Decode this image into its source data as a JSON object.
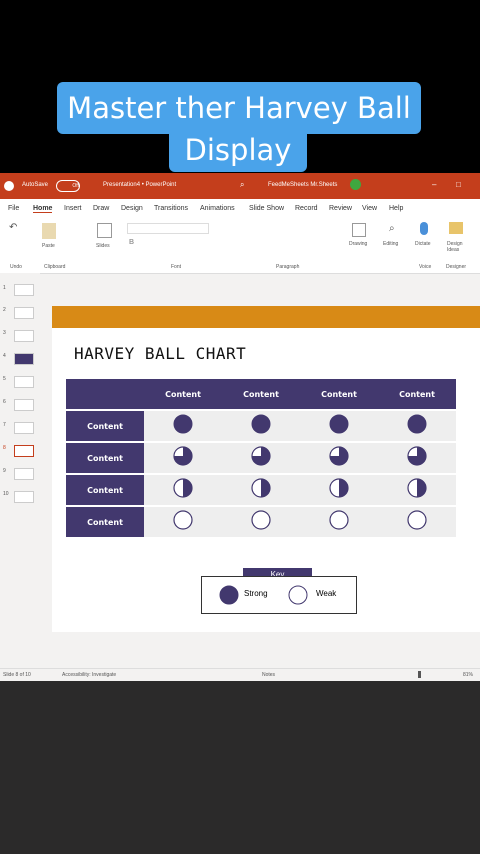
{
  "caption": {
    "line1": "Master ther Harvey Ball",
    "line2": "Display"
  },
  "titlebar": {
    "autosave": "AutoSave",
    "toggle": "Off",
    "filename": "Presentation4 • PowerPoint",
    "user": "FeedMeSheets Mr.Sheets"
  },
  "menu": [
    "File",
    "Home",
    "Insert",
    "Draw",
    "Design",
    "Transitions",
    "Animations",
    "Slide Show",
    "Record",
    "Review",
    "View",
    "Help"
  ],
  "ribbon": {
    "undo": "Undo",
    "clipboard": "Clipboard",
    "paste": "Paste",
    "slides": "Slides",
    "font": "Font",
    "paragraph": "Paragraph",
    "drawing": "Drawing",
    "editing": "Editing",
    "dictate": "Dictate",
    "voice": "Voice",
    "designer": "Design Ideas",
    "designer_group": "Designer"
  },
  "thumbnails": [
    "1",
    "2",
    "3",
    "4",
    "5",
    "6",
    "7",
    "8",
    "9",
    "10"
  ],
  "slide": {
    "title": "HARVEY BALL CHART",
    "headers": [
      "Content",
      "Content",
      "Content",
      "Content"
    ],
    "rows": [
      {
        "label": "Content",
        "values": [
          1,
          1,
          1,
          1
        ]
      },
      {
        "label": "Content",
        "values": [
          0.75,
          0.75,
          0.75,
          0.75
        ]
      },
      {
        "label": "Content",
        "values": [
          0.5,
          0.5,
          0.5,
          0.5
        ]
      },
      {
        "label": "Content",
        "values": [
          0,
          0,
          0,
          0
        ]
      }
    ],
    "key": {
      "title": "Key",
      "strong": "Strong",
      "weak": "Weak"
    }
  },
  "status": {
    "slide": "Slide 8 of 10",
    "accessibility": "Accessibility: Investigate",
    "notes": "Notes",
    "zoom": "81%"
  },
  "colors": {
    "accent": "#42386e",
    "ribbon": "#c43e1c",
    "orange": "#d88a16"
  }
}
